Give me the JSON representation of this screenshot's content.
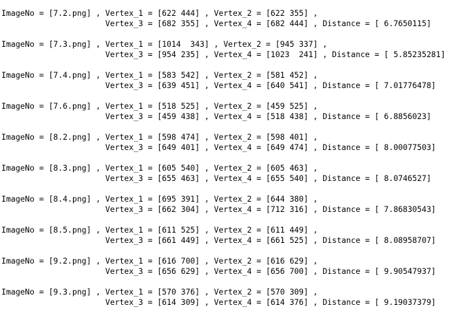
{
  "records": [
    {
      "line1": "ImageNo = [7.2.png] , Vertex_1 = [622 444] , Vertex_2 = [622 355] ,",
      "line2": "                      Vertex_3 = [682 355] , Vertex_4 = [682 444] , Distance = [ 6.7650115]"
    },
    {
      "line1": "ImageNo = [7.3.png] , Vertex_1 = [1014  343] , Vertex_2 = [945 337] ,",
      "line2": "                      Vertex_3 = [954 235] , Vertex_4 = [1023  241] , Distance = [ 5.85235281]"
    },
    {
      "line1": "ImageNo = [7.4.png] , Vertex_1 = [583 542] , Vertex_2 = [581 452] ,",
      "line2": "                      Vertex_3 = [639 451] , Vertex_4 = [640 541] , Distance = [ 7.01776478]"
    },
    {
      "line1": "ImageNo = [7.6.png] , Vertex_1 = [518 525] , Vertex_2 = [459 525] ,",
      "line2": "                      Vertex_3 = [459 438] , Vertex_4 = [518 438] , Distance = [ 6.8856023]"
    },
    {
      "line1": "ImageNo = [8.2.png] , Vertex_1 = [598 474] , Vertex_2 = [598 401] ,",
      "line2": "                      Vertex_3 = [649 401] , Vertex_4 = [649 474] , Distance = [ 8.00077503]"
    },
    {
      "line1": "ImageNo = [8.3.png] , Vertex_1 = [605 540] , Vertex_2 = [605 463] ,",
      "line2": "                      Vertex_3 = [655 463] , Vertex_4 = [655 540] , Distance = [ 8.0746527]"
    },
    {
      "line1": "ImageNo = [8.4.png] , Vertex_1 = [695 391] , Vertex_2 = [644 380] ,",
      "line2": "                      Vertex_3 = [662 304] , Vertex_4 = [712 316] , Distance = [ 7.86830543]"
    },
    {
      "line1": "ImageNo = [8.5.png] , Vertex_1 = [611 525] , Vertex_2 = [611 449] ,",
      "line2": "                      Vertex_3 = [661 449] , Vertex_4 = [661 525] , Distance = [ 8.08958707]"
    },
    {
      "line1": "ImageNo = [9.2.png] , Vertex_1 = [616 700] , Vertex_2 = [616 629] ,",
      "line2": "                      Vertex_3 = [656 629] , Vertex_4 = [656 700] , Distance = [ 9.90547937]"
    },
    {
      "line1": "ImageNo = [9.3.png] , Vertex_1 = [570 376] , Vertex_2 = [570 309] ,",
      "line2": "                      Vertex_3 = [614 309] , Vertex_4 = [614 376] , Distance = [ 9.19037379]"
    }
  ]
}
